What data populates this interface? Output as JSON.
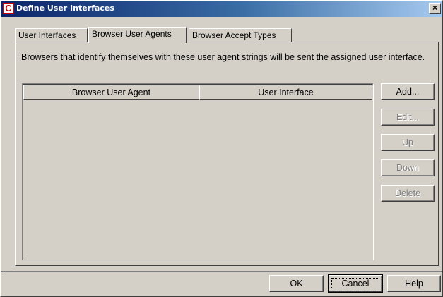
{
  "window": {
    "title": "Define User Interfaces",
    "icon_letter": "C",
    "close_glyph": "×"
  },
  "tabs": [
    {
      "label": "User Interfaces",
      "active": false
    },
    {
      "label": "Browser User Agents",
      "active": true
    },
    {
      "label": "Browser Accept Types",
      "active": false
    }
  ],
  "description": "Browsers that identify themselves with these user agent strings will be sent the assigned user interface.",
  "table": {
    "columns": [
      "Browser User Agent",
      "User Interface"
    ],
    "rows": []
  },
  "side_buttons": [
    {
      "label": "Add...",
      "enabled": true
    },
    {
      "label": "Edit...",
      "enabled": false
    },
    {
      "label": "Up",
      "enabled": false
    },
    {
      "label": "Down",
      "enabled": false
    },
    {
      "label": "Delete",
      "enabled": false
    }
  ],
  "footer_buttons": {
    "ok": "OK",
    "cancel": "Cancel",
    "help": "Help"
  }
}
